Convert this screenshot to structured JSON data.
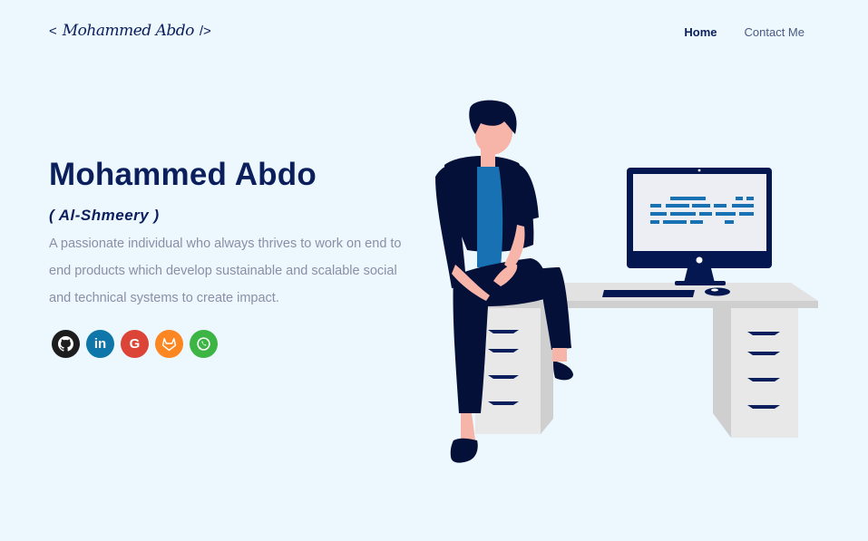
{
  "header": {
    "logo_open": "<",
    "logo_signature": "Mohammed Abdo",
    "logo_close": "/>",
    "nav": [
      {
        "label": "Home",
        "active": true
      },
      {
        "label": "Contact Me",
        "active": false
      }
    ]
  },
  "hero": {
    "name": "Mohammed Abdo",
    "alias": "( Al-Shmeery )",
    "description": "A passionate individual who always thrives to work on end to end products which develop sustainable and scalable social and technical systems to create impact."
  },
  "socials": [
    {
      "icon": "github-icon",
      "color": "#1d1d1d"
    },
    {
      "icon": "linkedin-icon",
      "color": "#0e76a8",
      "text": "in"
    },
    {
      "icon": "google-icon",
      "color": "#db4437",
      "text": "G"
    },
    {
      "icon": "gitlab-icon",
      "color": "#fc8621"
    },
    {
      "icon": "whatsapp-icon",
      "color": "#3cb545"
    }
  ],
  "colors": {
    "background": "#edf7fe",
    "primary": "#0a1f5c",
    "text_muted": "#8a8fa6",
    "accent_blue": "#1771b3"
  }
}
